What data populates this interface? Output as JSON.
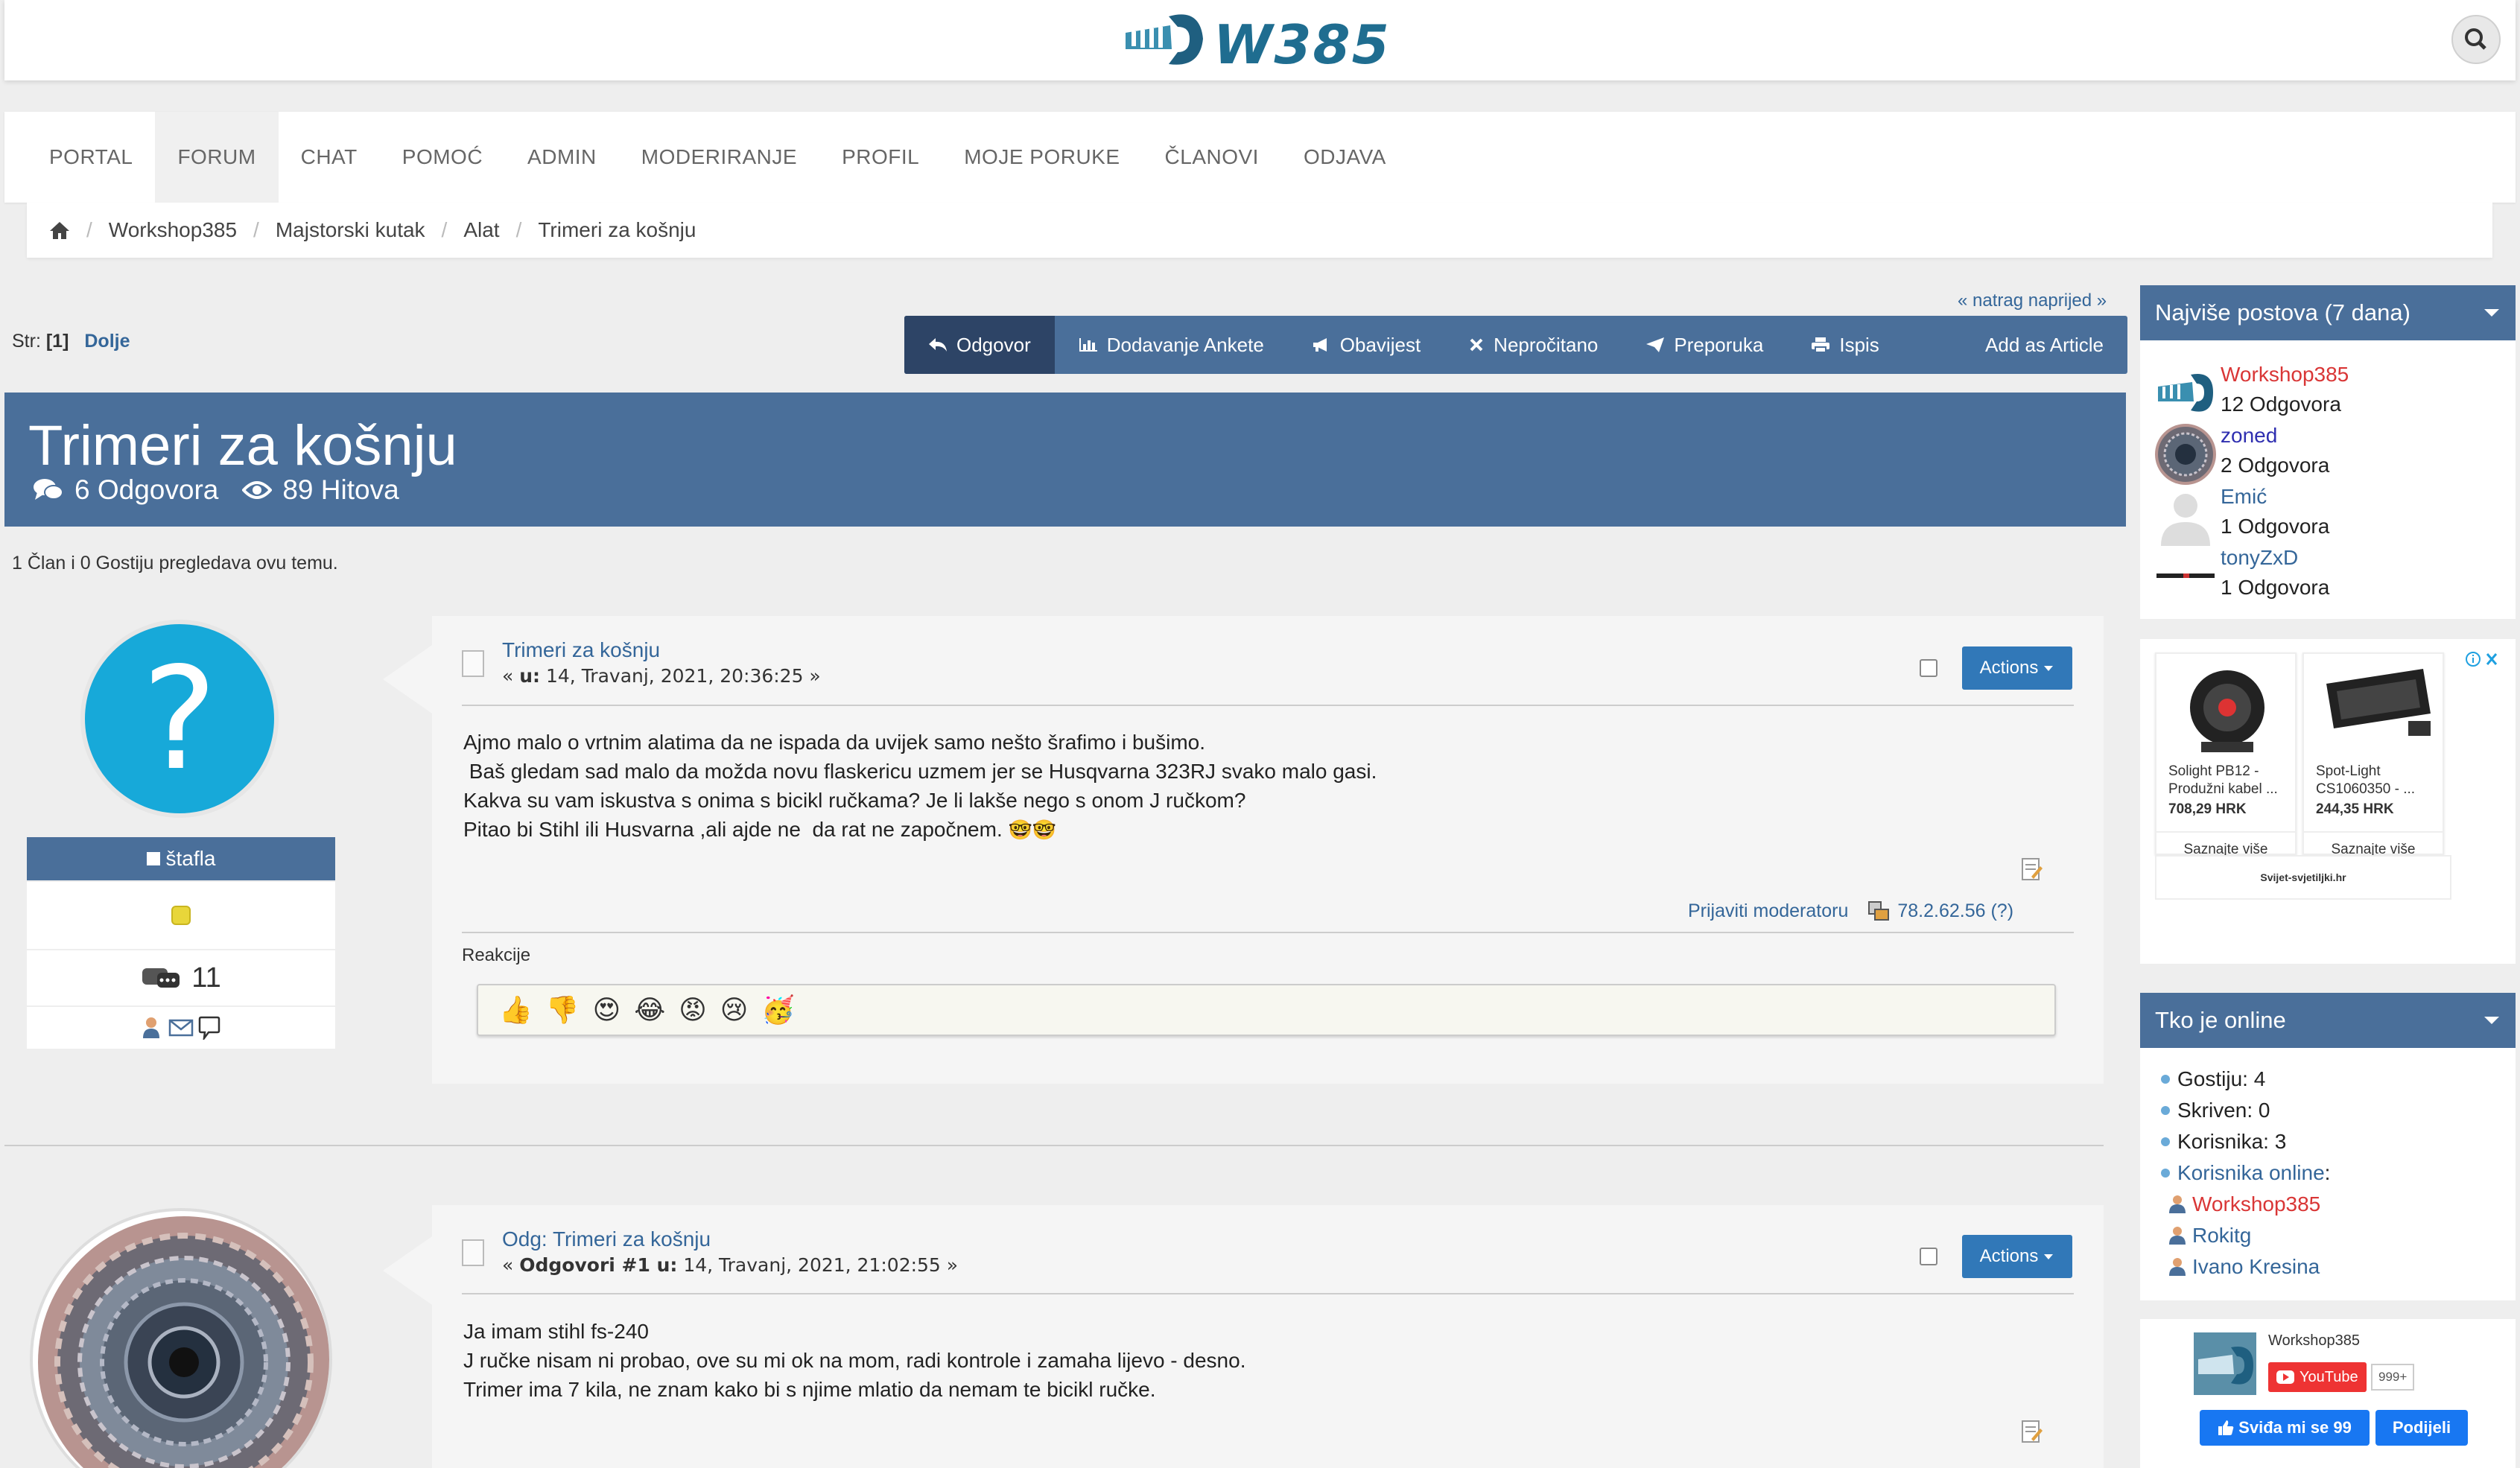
{
  "header": {
    "logo_text": "W385"
  },
  "menu": {
    "items": [
      {
        "label": "PORTAL"
      },
      {
        "label": "FORUM"
      },
      {
        "label": "CHAT"
      },
      {
        "label": "POMOĆ"
      },
      {
        "label": "ADMIN"
      },
      {
        "label": "MODERIRANJE"
      },
      {
        "label": "PROFIL"
      },
      {
        "label": "MOJE PORUKE"
      },
      {
        "label": "ČLANOVI"
      },
      {
        "label": "ODJAVA"
      }
    ],
    "active_index": 1
  },
  "breadcrumb": {
    "items": [
      "Workshop385",
      "Majstorski kutak",
      "Alat",
      "Trimeri za košnju"
    ]
  },
  "pagination": {
    "label": "Str:",
    "current": "[1]",
    "down_link": "Dolje"
  },
  "back_link": "« natrag naprijed »",
  "buttons": {
    "reply": "Odgovor",
    "poll": "Dodavanje Ankete",
    "notify": "Obavijest",
    "unread": "Nepročitano",
    "recommend": "Preporuka",
    "print": "Ispis",
    "article": "Add as Article"
  },
  "topic": {
    "title": "Trimeri za košnju",
    "replies": "6 Odgovora",
    "views": "89 Hitova",
    "viewers": "1 Član i 0 Gostiju pregledava ovu temu."
  },
  "posts": [
    {
      "author": "štafla",
      "post_count": "11",
      "subject": "Trimeri za košnju",
      "meta_prefix": "« ",
      "meta_bold": "u:",
      "meta_date": " 14, Travanj, 2021, 20:36:25 »",
      "body": "Ajmo malo o vrtnim alatima da ne ispada da uvijek samo nešto šrafimo i bušimo.\n Baš gledam sad malo da možda novu flaskericu uzmem jer se Husqvarna 323RJ svako malo gasi.\nKakva su vam iskustva s onima s bicikl ručkama? Je li lakše nego s onom J ručkom?\nPitao bi Stihl ili Husvarna ,ali ajde ne  da rat ne započnem. ",
      "body_emoji": "🤓🤓",
      "report": "Prijaviti moderatoru",
      "ip": "78.2.62.56 (?)",
      "reactions_label": "Reakcije",
      "reactions": [
        "👍",
        "👎",
        "😍",
        "😂",
        "😡",
        "😢",
        "🥳"
      ],
      "actions": "Actions"
    },
    {
      "subject": "Odg: Trimeri za košnju",
      "meta_prefix": "« ",
      "meta_bold": "Odgovori #1 u:",
      "meta_date": " 14, Travanj, 2021, 21:02:55 »",
      "body": "Ja imam stihl fs-240\nJ ručke nisam ni probao, ove su mi ok na mom, radi kontrole i zamaha lijevo - desno.\nTrimer ima 7 kila, ne znam kako bi s njime mlatio da nemam te bicikl ručke.",
      "actions": "Actions"
    }
  ],
  "sidebar": {
    "top_posters": {
      "title": "Najviše postova (7 dana)",
      "users": [
        {
          "name": "Workshop385",
          "count": "12 Odgovora",
          "color": "#d93636"
        },
        {
          "name": "zoned",
          "count": "2 Odgovora",
          "color": "#2f2fb0"
        },
        {
          "name": "Emić",
          "count": "1 Odgovora",
          "color": "#346699"
        },
        {
          "name": "tonyZxD",
          "count": "1 Odgovora",
          "color": "#346699"
        }
      ]
    },
    "ad": {
      "items": [
        {
          "name": "Solight PB12 - Produžni kabel ...",
          "price": "708,29 HRK",
          "cta": "Saznajte više"
        },
        {
          "name": "Spot-Light CS1060350 - ...",
          "price": "244,35 HRK",
          "cta": "Saznajte više"
        }
      ],
      "brand": "Svijet-svjetiljki.hr"
    },
    "online": {
      "title": "Tko je online",
      "stats": [
        "Gostiju: 4",
        "Skriven: 0",
        "Korisnika: 3"
      ],
      "online_label": "Korisnika online",
      "users": [
        {
          "name": "Workshop385",
          "color": "#d93636"
        },
        {
          "name": "Rokitg",
          "color": "#346699"
        },
        {
          "name": "Ivano Kresina",
          "color": "#346699"
        }
      ]
    },
    "social": {
      "channel": "Workshop385",
      "youtube": "YouTube",
      "yt_count": "999+",
      "like": "Sviđa mi se 99",
      "share": "Podijeli"
    }
  }
}
